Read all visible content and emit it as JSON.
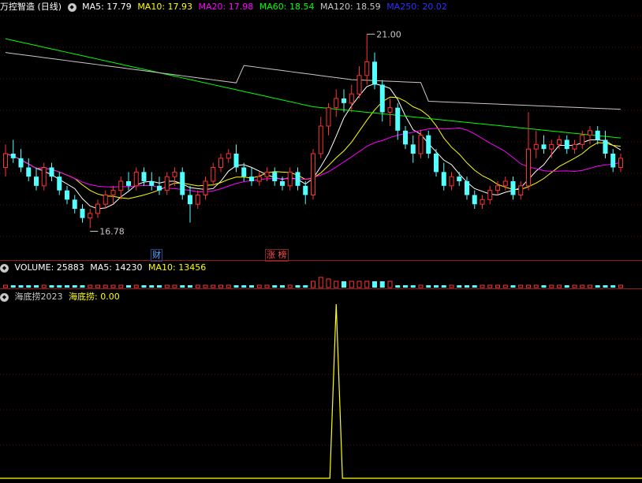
{
  "header_main": {
    "title": "万控智造 (日线)",
    "indicators": [
      {
        "label": "MA5: 17.79",
        "color": "#ffffff"
      },
      {
        "label": "MA10: 17.93",
        "color": "#ffff00"
      },
      {
        "label": "MA20: 17.98",
        "color": "#ff00ff"
      },
      {
        "label": "MA60: 18.54",
        "color": "#00ff00"
      },
      {
        "label": "MA120: 18.59",
        "color": "#c8c8c8"
      },
      {
        "label": "MA250: 20.02",
        "color": "#3030ff"
      }
    ]
  },
  "header_volume": {
    "label": "VOLUME: 25883",
    "ma5": "MA5: 14230",
    "ma10": "MA10: 13456"
  },
  "header_indicator": {
    "name": "海底捞2023",
    "value_label": "海底捞: 0.00"
  },
  "annotations": {
    "high": "21.00",
    "low": "16.78",
    "tag_finance": "财",
    "tag_limit": "涨 榜"
  },
  "colors": {
    "up": "#ff3232",
    "down": "#54ffff",
    "ma5": "#ffffff",
    "ma10": "#ffff00",
    "ma20": "#ff00ff",
    "ma60": "#00ff00",
    "ma120": "#c8c8c8",
    "indicator_line": "#ffff00",
    "separator": "#8b1e1e"
  },
  "chart_data": {
    "type": "candlestick",
    "ylim": [
      16.6,
      21.4
    ],
    "candles": [
      [
        18.1,
        18.6,
        17.9,
        18.4
      ],
      [
        18.4,
        18.7,
        18.2,
        18.3
      ],
      [
        18.3,
        18.5,
        18.0,
        18.1
      ],
      [
        18.1,
        18.3,
        17.8,
        17.9
      ],
      [
        17.9,
        18.1,
        17.6,
        17.7
      ],
      [
        17.7,
        18.2,
        17.6,
        18.1
      ],
      [
        18.1,
        18.2,
        17.8,
        17.9
      ],
      [
        17.9,
        18.0,
        17.5,
        17.6
      ],
      [
        17.6,
        17.7,
        17.3,
        17.4
      ],
      [
        17.4,
        17.5,
        17.1,
        17.2
      ],
      [
        17.2,
        17.3,
        16.9,
        17.0
      ],
      [
        17.0,
        17.2,
        16.78,
        17.1
      ],
      [
        17.1,
        17.4,
        17.0,
        17.3
      ],
      [
        17.3,
        17.6,
        17.2,
        17.5
      ],
      [
        17.5,
        17.7,
        17.3,
        17.6
      ],
      [
        17.6,
        17.9,
        17.4,
        17.8
      ],
      [
        17.8,
        18.0,
        17.6,
        17.7
      ],
      [
        17.7,
        18.1,
        17.6,
        18.0
      ],
      [
        18.0,
        18.1,
        17.7,
        17.8
      ],
      [
        17.8,
        18.0,
        17.6,
        17.7
      ],
      [
        17.7,
        17.9,
        17.5,
        17.6
      ],
      [
        17.6,
        18.0,
        17.5,
        17.9
      ],
      [
        17.9,
        18.1,
        17.7,
        18.0
      ],
      [
        18.0,
        18.1,
        17.4,
        17.5
      ],
      [
        17.5,
        17.7,
        16.9,
        17.3
      ],
      [
        17.3,
        17.6,
        17.2,
        17.5
      ],
      [
        17.5,
        17.9,
        17.4,
        17.8
      ],
      [
        17.8,
        18.2,
        17.7,
        18.1
      ],
      [
        18.1,
        18.4,
        18.0,
        18.3
      ],
      [
        18.3,
        18.5,
        18.2,
        18.4
      ],
      [
        18.4,
        18.6,
        18.0,
        18.1
      ],
      [
        18.1,
        18.2,
        17.8,
        17.9
      ],
      [
        17.9,
        18.1,
        17.7,
        17.8
      ],
      [
        17.8,
        18.0,
        17.7,
        17.9
      ],
      [
        17.9,
        18.1,
        17.8,
        18.0
      ],
      [
        18.0,
        18.1,
        17.7,
        17.8
      ],
      [
        17.8,
        17.9,
        17.6,
        17.7
      ],
      [
        17.7,
        18.1,
        17.6,
        18.0
      ],
      [
        18.0,
        18.1,
        17.6,
        17.7
      ],
      [
        17.7,
        17.8,
        17.3,
        17.5
      ],
      [
        17.5,
        18.5,
        17.4,
        18.4
      ],
      [
        18.4,
        19.2,
        18.3,
        19.0
      ],
      [
        19.0,
        19.5,
        18.8,
        19.4
      ],
      [
        19.4,
        19.8,
        19.2,
        19.6
      ],
      [
        19.6,
        19.8,
        19.3,
        19.5
      ],
      [
        19.5,
        19.9,
        19.3,
        19.7
      ],
      [
        19.7,
        20.3,
        19.6,
        20.1
      ],
      [
        20.1,
        21.0,
        19.9,
        20.4
      ],
      [
        20.4,
        20.6,
        19.8,
        19.9
      ],
      [
        19.9,
        20.0,
        19.1,
        19.3
      ],
      [
        19.3,
        19.6,
        19.0,
        19.4
      ],
      [
        19.4,
        19.5,
        18.7,
        18.9
      ],
      [
        18.9,
        19.0,
        18.5,
        18.6
      ],
      [
        18.6,
        18.8,
        18.2,
        18.4
      ],
      [
        18.4,
        18.9,
        18.3,
        18.8
      ],
      [
        18.8,
        18.9,
        18.3,
        18.4
      ],
      [
        18.4,
        18.5,
        17.9,
        18.0
      ],
      [
        18.0,
        18.2,
        17.6,
        17.7
      ],
      [
        17.7,
        18.0,
        17.6,
        17.9
      ],
      [
        17.9,
        18.0,
        17.7,
        17.8
      ],
      [
        17.8,
        17.9,
        17.4,
        17.5
      ],
      [
        17.5,
        17.6,
        17.2,
        17.3
      ],
      [
        17.3,
        17.5,
        17.2,
        17.4
      ],
      [
        17.4,
        17.7,
        17.3,
        17.6
      ],
      [
        17.6,
        17.8,
        17.5,
        17.7
      ],
      [
        17.7,
        17.9,
        17.6,
        17.8
      ],
      [
        17.8,
        17.9,
        17.4,
        17.5
      ],
      [
        17.5,
        17.8,
        17.4,
        17.7
      ],
      [
        17.7,
        19.3,
        17.6,
        18.5
      ],
      [
        18.5,
        18.9,
        18.3,
        18.6
      ],
      [
        18.6,
        18.8,
        18.4,
        18.5
      ],
      [
        18.5,
        18.7,
        18.3,
        18.6
      ],
      [
        18.6,
        18.8,
        18.5,
        18.7
      ],
      [
        18.7,
        18.8,
        18.4,
        18.5
      ],
      [
        18.5,
        18.7,
        18.4,
        18.6
      ],
      [
        18.6,
        18.9,
        18.5,
        18.8
      ],
      [
        18.8,
        19.0,
        18.6,
        18.9
      ],
      [
        18.9,
        19.0,
        18.6,
        18.7
      ],
      [
        18.7,
        18.9,
        18.3,
        18.4
      ],
      [
        18.4,
        18.5,
        18.0,
        18.1
      ],
      [
        18.1,
        18.4,
        18.0,
        18.3
      ]
    ],
    "volume_header": "VOLUME: 25883",
    "indicator_spike_index": 43
  }
}
